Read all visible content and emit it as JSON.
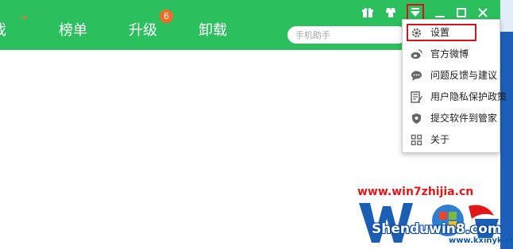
{
  "header": {
    "tabs": [
      {
        "label": "游戏",
        "shown_label": "戏"
      },
      {
        "label": "榜单"
      },
      {
        "label": "升级",
        "badge": "6"
      },
      {
        "label": "卸载"
      }
    ],
    "search_placeholder": "手机助手"
  },
  "window_controls": [
    "gift-icon",
    "skin-icon",
    "menu-icon",
    "minimize-icon",
    "maximize-icon",
    "close-icon"
  ],
  "dropdown": {
    "items": [
      {
        "label": "设置",
        "icon": "gear-icon",
        "highlighted": true
      },
      {
        "label": "官方微博",
        "icon": "weibo-icon"
      },
      {
        "label": "问题反馈与建议",
        "icon": "chat-icon"
      },
      {
        "label": "用户隐私保护政策",
        "icon": "document-icon"
      },
      {
        "label": "提交软件到管家",
        "icon": "shield-icon"
      },
      {
        "label": "关于",
        "icon": "grid-icon"
      }
    ]
  },
  "watermark": {
    "url_top": "www.win7zhijia.cn",
    "brand": "Shenduwin8.com",
    "url_bottom": "www.kxinyk.com"
  },
  "colors": {
    "header_green": "#2bbf5d",
    "highlight_red": "#d6121b",
    "badge_orange": "#f36b2a"
  }
}
